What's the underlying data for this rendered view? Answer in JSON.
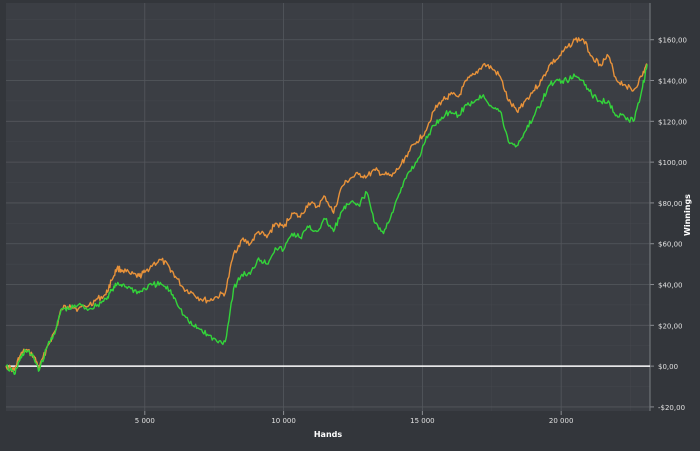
{
  "chart_data": {
    "type": "line",
    "title": "",
    "xlabel": "Hands",
    "ylabel": "Winnings",
    "xlim": [
      0,
      23200
    ],
    "ylim": [
      -22,
      178
    ],
    "grid": true,
    "x_ticks": [
      {
        "value": 5000,
        "label": "5 000"
      },
      {
        "value": 10000,
        "label": "10 000"
      },
      {
        "value": 15000,
        "label": "15 000"
      },
      {
        "value": 20000,
        "label": "20 000"
      }
    ],
    "y_ticks": [
      {
        "value": -20,
        "label": "-$20,00"
      },
      {
        "value": 0,
        "label": "$0,00"
      },
      {
        "value": 20,
        "label": "$20,00"
      },
      {
        "value": 40,
        "label": "$40,00"
      },
      {
        "value": 60,
        "label": "$60,00"
      },
      {
        "value": 80,
        "label": "$80,00"
      },
      {
        "value": 100,
        "label": "$100,00"
      },
      {
        "value": 120,
        "label": "$120,00"
      },
      {
        "value": 140,
        "label": "$140,00"
      },
      {
        "value": 160,
        "label": "$160,00"
      }
    ],
    "x": [
      0,
      300,
      500,
      700,
      1000,
      1200,
      1500,
      1800,
      2000,
      2300,
      2600,
      3000,
      3300,
      3600,
      3800,
      4000,
      4200,
      4500,
      4800,
      5000,
      5300,
      5600,
      5900,
      6100,
      6400,
      6700,
      7000,
      7300,
      7600,
      7900,
      8200,
      8500,
      8800,
      9100,
      9400,
      9700,
      10000,
      10300,
      10600,
      10900,
      11200,
      11500,
      11800,
      12100,
      12400,
      12700,
      13000,
      13300,
      13600,
      13900,
      14200,
      14500,
      14800,
      15100,
      15400,
      15700,
      16000,
      16300,
      16600,
      16900,
      17200,
      17500,
      17800,
      18100,
      18400,
      18700,
      19000,
      19300,
      19600,
      19900,
      20200,
      20500,
      20800,
      21100,
      21400,
      21700,
      22000,
      22300,
      22600,
      22900,
      23100
    ],
    "series": [
      {
        "color": "#e8923a",
        "values": [
          0,
          -2,
          5,
          8,
          5,
          -1,
          10,
          18,
          28,
          30,
          28,
          30,
          33,
          35,
          42,
          48,
          47,
          45,
          44,
          46,
          50,
          52,
          48,
          44,
          38,
          36,
          33,
          32,
          34,
          36,
          55,
          62,
          60,
          66,
          63,
          70,
          68,
          75,
          73,
          80,
          78,
          83,
          75,
          88,
          92,
          94,
          93,
          96,
          94,
          93,
          98,
          105,
          110,
          115,
          125,
          130,
          133,
          132,
          140,
          143,
          148,
          146,
          142,
          130,
          125,
          130,
          135,
          140,
          148,
          151,
          156,
          160,
          160,
          152,
          148,
          152,
          140,
          138,
          135,
          142,
          148
        ]
      },
      {
        "color": "#33d43a",
        "values": [
          0,
          -4,
          3,
          8,
          4,
          -2,
          10,
          18,
          28,
          28,
          30,
          28,
          30,
          33,
          37,
          40,
          40,
          38,
          36,
          38,
          40,
          40,
          37,
          33,
          25,
          20,
          18,
          15,
          12,
          12,
          38,
          45,
          45,
          53,
          50,
          58,
          57,
          65,
          63,
          68,
          66,
          72,
          66,
          76,
          80,
          79,
          85,
          70,
          65,
          75,
          85,
          95,
          100,
          110,
          118,
          122,
          125,
          123,
          128,
          130,
          133,
          127,
          125,
          110,
          108,
          115,
          122,
          130,
          138,
          140,
          140,
          142,
          140,
          133,
          130,
          130,
          123,
          122,
          120,
          135,
          148
        ]
      }
    ]
  }
}
